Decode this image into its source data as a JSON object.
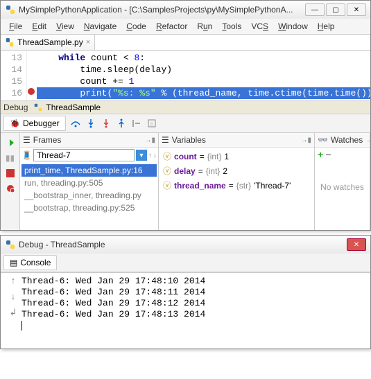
{
  "main": {
    "title": "MySimplePythonApplication - [C:\\SamplesProjects\\py\\MySimplePythonA...",
    "menu": [
      "File",
      "Edit",
      "View",
      "Navigate",
      "Code",
      "Refactor",
      "Run",
      "Tools",
      "VCS",
      "Window",
      "Help"
    ],
    "file_tab": "ThreadSample.py",
    "gutter": [
      "13",
      "14",
      "15",
      "16"
    ],
    "code": {
      "l13_a": "while",
      "l13_b": " count < ",
      "l13_c": "8",
      "l13_d": ":",
      "l14": "time.sleep(delay)",
      "l15_a": "count += ",
      "l15_b": "1",
      "l16_a": "print",
      "l16_b": "(",
      "l16_str": "\"%s: %s\"",
      "l16_c": " % (thread_name, time.ctime(time.time())))"
    },
    "debug_label": "Debug",
    "debug_target": "ThreadSample",
    "debugger_tab": "Debugger",
    "frames": {
      "title": "Frames",
      "thread": "Thread-7",
      "stack": [
        "print_time, ThreadSample.py:16",
        "run, threading.py:505",
        "__bootstrap_inner, threading.py",
        "__bootstrap, threading.py:525"
      ]
    },
    "variables": {
      "title": "Variables",
      "items": [
        {
          "name": "count",
          "type": "{int}",
          "value": "1"
        },
        {
          "name": "delay",
          "type": "{int}",
          "value": "2"
        },
        {
          "name": "thread_name",
          "type": "{str}",
          "value": "'Thread-7'"
        }
      ]
    },
    "watches": {
      "title": "Watches",
      "empty": "No watches"
    }
  },
  "debugwin": {
    "title": "Debug - ThreadSample",
    "console_tab": "Console",
    "lines": [
      "Thread-6: Wed Jan 29 17:48:10 2014",
      "Thread-6: Wed Jan 29 17:48:11 2014",
      "Thread-6: Wed Jan 29 17:48:12 2014",
      "Thread-6: Wed Jan 29 17:48:13 2014"
    ]
  }
}
